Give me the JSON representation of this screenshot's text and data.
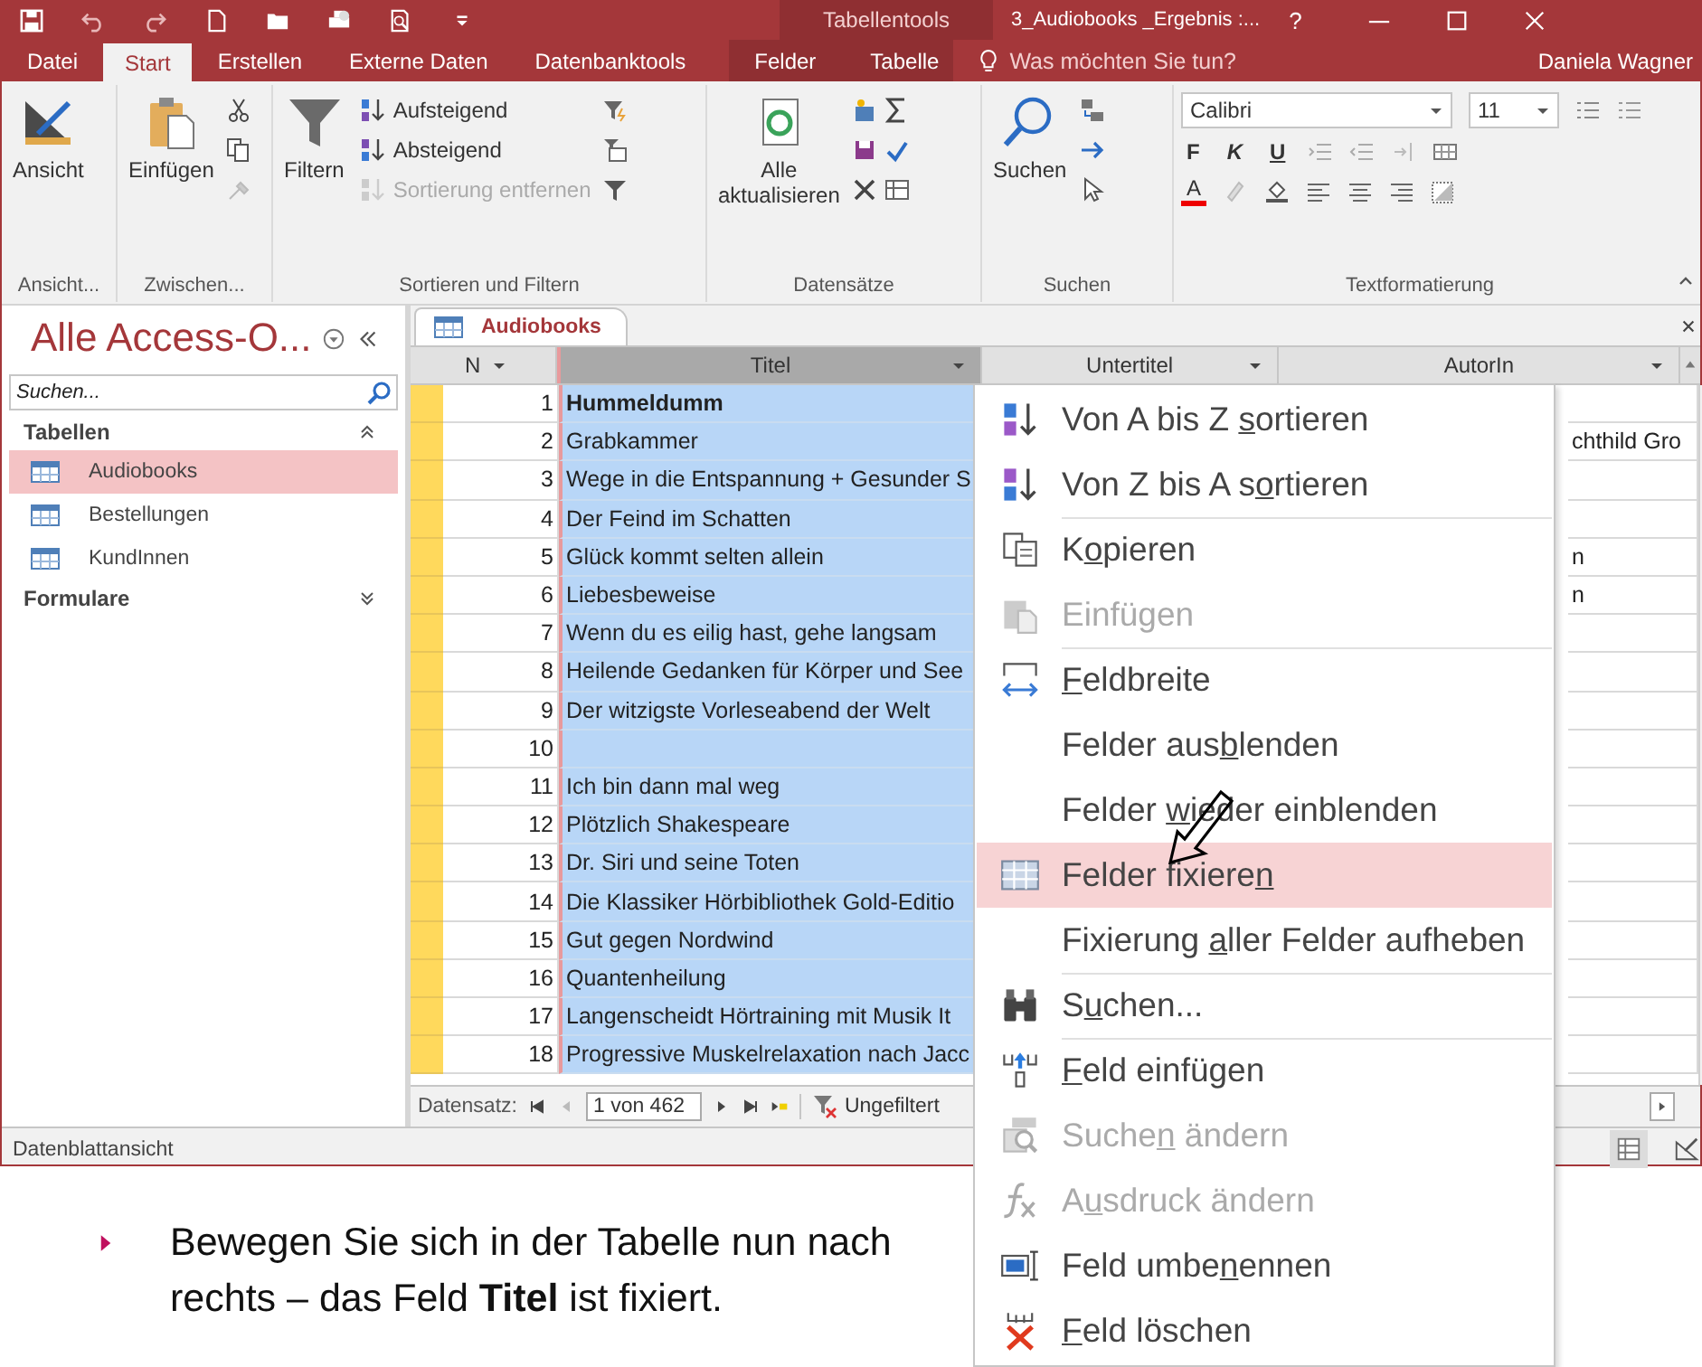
{
  "title_bar": {
    "context_label": "Tabellentools",
    "title": "3_Audiobooks _Ergebnis :...",
    "help": "?"
  },
  "menu_tabs": [
    {
      "label": "Datei",
      "selected": false,
      "contextual": false
    },
    {
      "label": "Start",
      "selected": true,
      "contextual": false
    },
    {
      "label": "Erstellen",
      "selected": false,
      "contextual": false
    },
    {
      "label": "Externe Daten",
      "selected": false,
      "contextual": false
    },
    {
      "label": "Datenbanktools",
      "selected": false,
      "contextual": false
    },
    {
      "label": "Felder",
      "selected": false,
      "contextual": true
    },
    {
      "label": "Tabelle",
      "selected": false,
      "contextual": true
    }
  ],
  "tell_me": "Was möchten Sie tun?",
  "user": "Daniela Wagner",
  "ribbon": {
    "ansicht": {
      "button": "Ansicht",
      "group": "Ansicht..."
    },
    "zwischenablage": {
      "button": "Einfügen",
      "group": "Zwischen..."
    },
    "sortieren": {
      "button": "Filtern",
      "items": [
        {
          "label": "Aufsteigend",
          "disabled": false
        },
        {
          "label": "Absteigend",
          "disabled": false
        },
        {
          "label": "Sortierung entfernen",
          "disabled": true
        }
      ],
      "group": "Sortieren und Filtern"
    },
    "datensaetze": {
      "button_lines": [
        "Alle",
        "aktualisieren"
      ],
      "group": "Datensätze"
    },
    "suchen": {
      "button": "Suchen",
      "group": "Suchen"
    },
    "text": {
      "font": "Calibri",
      "size": "11",
      "styles": [
        "F",
        "K",
        "U"
      ],
      "font_color_letter": "A",
      "group": "Textformatierung"
    }
  },
  "nav_pane": {
    "title": "Alle Access-O...",
    "search": {
      "placeholder": "Suchen..."
    },
    "sections": [
      {
        "label": "Tabellen",
        "expanded": true,
        "items": [
          {
            "label": "Audiobooks",
            "selected": true
          },
          {
            "label": "Bestellungen",
            "selected": false
          },
          {
            "label": "KundInnen",
            "selected": false
          }
        ]
      },
      {
        "label": "Formulare",
        "expanded": false
      }
    ]
  },
  "datasheet": {
    "tab": "Audiobooks",
    "columns": [
      {
        "label": "N",
        "selected": false
      },
      {
        "label": "Titel",
        "selected": true
      },
      {
        "label": "Untertitel",
        "selected": false
      },
      {
        "label": "AutorIn",
        "selected": false
      }
    ],
    "rows": [
      {
        "n": "1",
        "titel": "Hummeldumm"
      },
      {
        "n": "2",
        "titel": "Grabkammer",
        "autorin": "chthild Gro"
      },
      {
        "n": "3",
        "titel": "Wege in die Entspannung + Gesunder S"
      },
      {
        "n": "4",
        "titel": "Der Feind im Schatten"
      },
      {
        "n": "5",
        "titel": "Glück kommt selten allein",
        "autorin": "n"
      },
      {
        "n": "6",
        "titel": "Liebesbeweise",
        "autorin": "n"
      },
      {
        "n": "7",
        "titel": "Wenn du es eilig hast, gehe langsam"
      },
      {
        "n": "8",
        "titel": "Heilende Gedanken für Körper und See"
      },
      {
        "n": "9",
        "titel": "Der witzigste Vorleseabend der Welt"
      },
      {
        "n": "10"
      },
      {
        "n": "11",
        "titel": "Ich bin dann mal weg"
      },
      {
        "n": "12",
        "titel": "Plötzlich Shakespeare"
      },
      {
        "n": "13",
        "titel": "Dr. Siri und seine Toten"
      },
      {
        "n": "14",
        "titel": "Die Klassiker Hörbibliothek Gold-Editio"
      },
      {
        "n": "15",
        "titel": "Gut gegen Nordwind"
      },
      {
        "n": "16",
        "titel": "Quantenheilung"
      },
      {
        "n": "17",
        "titel": "Langenscheidt Hörtraining mit Musik It"
      },
      {
        "n": "18",
        "titel": "Progressive Muskelrelaxation nach Jacc"
      }
    ],
    "record_label": "Datensatz:",
    "record": "1 von 462",
    "filter": "Ungefiltert"
  },
  "status_bar": "Datenblattansicht",
  "context_menu": [
    {
      "pre": "Von A bis Z ",
      "key": "s",
      "post": "ortieren",
      "disabled": false,
      "selected": false,
      "separator_before": false
    },
    {
      "pre": "Von Z bis A s",
      "key": "o",
      "post": "rtieren",
      "disabled": false,
      "selected": false,
      "separator_before": false
    },
    {
      "pre": "K",
      "key": "o",
      "post": "pieren",
      "disabled": false,
      "selected": false,
      "separator_before": true
    },
    {
      "pre": "Einfü",
      "key": "g",
      "post": "en",
      "disabled": true,
      "selected": false,
      "separator_before": false
    },
    {
      "key": "F",
      "post": "eldbreite",
      "disabled": false,
      "selected": false,
      "separator_before": true
    },
    {
      "pre": "Felder aus",
      "key": "b",
      "post": "lenden",
      "disabled": false,
      "selected": false,
      "separator_before": false
    },
    {
      "pre": "Felder ",
      "key": "w",
      "post": "ieder einblenden",
      "disabled": false,
      "selected": false,
      "separator_before": false
    },
    {
      "pre": "Felder fixiere",
      "key": "n",
      "disabled": false,
      "selected": true,
      "separator_before": false
    },
    {
      "pre": "Fixierung ",
      "key": "a",
      "post": "ller Felder aufheben",
      "disabled": false,
      "selected": false,
      "separator_before": false
    },
    {
      "pre": "S",
      "key": "u",
      "post": "chen...",
      "disabled": false,
      "selected": false,
      "separator_before": true
    },
    {
      "key": "F",
      "post": "eld einfügen",
      "disabled": false,
      "selected": false,
      "separator_before": true
    },
    {
      "pre": "Suche",
      "key": "n",
      "post": " ändern",
      "disabled": true,
      "selected": false,
      "separator_before": false
    },
    {
      "pre": "A",
      "key": "u",
      "post": "sdruck ändern",
      "disabled": true,
      "selected": false,
      "separator_before": false
    },
    {
      "pre": "Feld umbe",
      "key": "n",
      "post": "ennen",
      "disabled": false,
      "selected": false,
      "separator_before": false
    },
    {
      "key": "F",
      "post": "eld löschen",
      "disabled": false,
      "selected": false,
      "separator_before": false
    }
  ],
  "instruction": "Bewegen Sie sich in der Tabelle nun nach rechts – das Feld **Titel** ist fixiert."
}
